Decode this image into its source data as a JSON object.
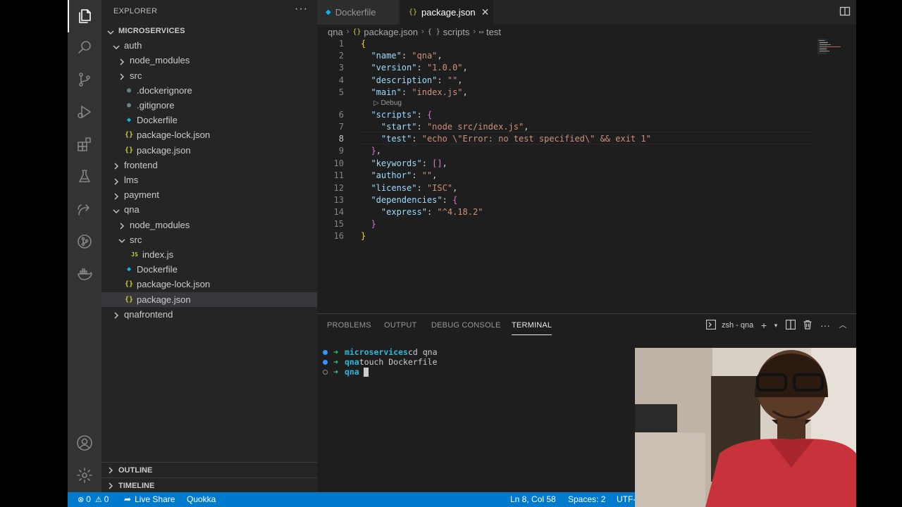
{
  "explorer": {
    "title": "EXPLORER",
    "more": "···",
    "tree": [
      {
        "label": "MICROSERVICES",
        "indent": 0,
        "kind": "root",
        "chevron": "down"
      },
      {
        "label": "auth",
        "indent": 1,
        "kind": "folder",
        "chevron": "down"
      },
      {
        "label": "node_modules",
        "indent": 2,
        "kind": "folder",
        "chevron": "right"
      },
      {
        "label": "src",
        "indent": 2,
        "kind": "folder",
        "chevron": "right"
      },
      {
        "label": ".dockerignore",
        "indent": 2,
        "kind": "ignore"
      },
      {
        "label": ".gitignore",
        "indent": 2,
        "kind": "ignore"
      },
      {
        "label": "Dockerfile",
        "indent": 2,
        "kind": "docker"
      },
      {
        "label": "package-lock.json",
        "indent": 2,
        "kind": "json"
      },
      {
        "label": "package.json",
        "indent": 2,
        "kind": "json"
      },
      {
        "label": "frontend",
        "indent": 1,
        "kind": "folder",
        "chevron": "right"
      },
      {
        "label": "lms",
        "indent": 1,
        "kind": "folder",
        "chevron": "right"
      },
      {
        "label": "payment",
        "indent": 1,
        "kind": "folder",
        "chevron": "right"
      },
      {
        "label": "qna",
        "indent": 1,
        "kind": "folder",
        "chevron": "down"
      },
      {
        "label": "node_modules",
        "indent": 2,
        "kind": "folder",
        "chevron": "right"
      },
      {
        "label": "src",
        "indent": 2,
        "kind": "folder",
        "chevron": "down"
      },
      {
        "label": "index.js",
        "indent": 3,
        "kind": "js"
      },
      {
        "label": "Dockerfile",
        "indent": 2,
        "kind": "docker"
      },
      {
        "label": "package-lock.json",
        "indent": 2,
        "kind": "json"
      },
      {
        "label": "package.json",
        "indent": 2,
        "kind": "json",
        "selected": true
      },
      {
        "label": "qnafrontend",
        "indent": 1,
        "kind": "folder",
        "chevron": "right"
      }
    ],
    "outline": "OUTLINE",
    "timeline": "TIMELINE"
  },
  "tabs": [
    {
      "label": "Dockerfile",
      "icon": "docker"
    },
    {
      "label": "package.json",
      "icon": "{}",
      "close": "✕"
    }
  ],
  "breadcrumb": {
    "folder": "qna",
    "file": "package.json",
    "key1": "scripts",
    "key2": "test",
    "sep": "›",
    "obj": "{ }"
  },
  "editor": {
    "lines": [
      "1",
      "2",
      "3",
      "4",
      "5",
      "6",
      "7",
      "8",
      "9",
      "10",
      "11",
      "12",
      "13",
      "14",
      "15",
      "16"
    ],
    "codelens": "Debug",
    "code": {
      "l1": "{",
      "name_k": "\"name\"",
      "name_v": "\"qna\"",
      "version_k": "\"version\"",
      "version_v": "\"1.0.0\"",
      "desc_k": "\"description\"",
      "desc_v": "\"\"",
      "main_k": "\"main\"",
      "main_v": "\"index.js\"",
      "scripts_k": "\"scripts\"",
      "open2": "{",
      "start_k": "\"start\"",
      "start_v": "\"node src/index.js\"",
      "test_k": "\"test\"",
      "test_v": "\"echo \\\"Error: no test specified\\\" && exit 1\"",
      "close2": "}",
      "keywords_k": "\"keywords\"",
      "keywords_v": "[]",
      "author_k": "\"author\"",
      "author_v": "\"\"",
      "license_k": "\"license\"",
      "license_v": "\"ISC\"",
      "deps_k": "\"dependencies\"",
      "open3": "{",
      "express_k": "\"express\"",
      "express_v": "\"^4.18.2\"",
      "close3": "}",
      "l16": "}"
    }
  },
  "panel": {
    "tabs": [
      "PROBLEMS",
      "OUTPUT",
      "DEBUG CONSOLE",
      "TERMINAL"
    ],
    "terminal_name": "zsh - qna",
    "terminal": [
      {
        "dir": "microservices",
        "cmd": "cd qna"
      },
      {
        "dir": "qna",
        "cmd": "touch Dockerfile"
      },
      {
        "dir": "qna",
        "cmd": ""
      }
    ],
    "arrow": "➜"
  },
  "status": {
    "errors": "0",
    "warnings": "0",
    "liveshare": "Live Share",
    "quokka": "Quokka",
    "position": "Ln 8, Col 58",
    "spaces": "Spaces: 2",
    "encoding": "UTF-"
  },
  "colors": {
    "accent": "#007acc",
    "sidebar": "#252526",
    "editor": "#1e1e1e",
    "activity": "#333333"
  }
}
